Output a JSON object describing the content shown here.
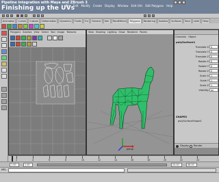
{
  "video_title": {
    "main": "Pipeline integration with Maya and ZBrush 3",
    "subtitle": "Finishing up the UVs"
  },
  "app_menu": [
    "File",
    "Edit",
    "Modify",
    "Create",
    "Display",
    "Window",
    "Edit UVs",
    "Edit Polygons",
    "Help"
  ],
  "shelf_tabs": [
    "Animation",
    "Curves",
    "Custom",
    "Deformation",
    "Dynamics",
    "Fluids",
    "Fur",
    "General",
    "Hair",
    "PaintEffects",
    "Polygons",
    "Rendering",
    "Subdivs",
    "Surfaces",
    "Toon",
    "cloth",
    "Heav"
  ],
  "uv_editor": {
    "menu": [
      "Polygons",
      "Subdivs",
      "View",
      "Select",
      "Tool",
      "Image",
      "Textures"
    ]
  },
  "scene_view": {
    "menu": [
      "View",
      "Shading",
      "Lighting",
      "Show",
      "Renderer",
      "Panels"
    ],
    "camera": "persp"
  },
  "channel_box": {
    "tabs": [
      "Channels",
      "Object"
    ],
    "object_name": "polySurface1",
    "attributes": [
      {
        "name": "Translate X",
        "value": "0"
      },
      {
        "name": "Translate Y",
        "value": "0"
      },
      {
        "name": "Translate Z",
        "value": "0"
      },
      {
        "name": "Rotate X",
        "value": "0"
      },
      {
        "name": "Rotate Y",
        "value": "0"
      },
      {
        "name": "Rotate Z",
        "value": "0"
      },
      {
        "name": "Scale X",
        "value": "1"
      },
      {
        "name": "Scale Y",
        "value": "1"
      },
      {
        "name": "Scale Z",
        "value": "1"
      },
      {
        "name": "Visibility",
        "value": "on"
      }
    ],
    "shapes_header": "SHAPES",
    "shape_name": "polySurfaceShape1",
    "layer_modes": [
      "Display",
      "Render"
    ]
  },
  "timeline": {
    "ticks": [
      "2",
      "4",
      "6",
      "8",
      "10",
      "12",
      "14",
      "16",
      "18",
      "20",
      "22",
      "24"
    ],
    "start": "1.00",
    "range_start": "1.00",
    "range_end": "24.00",
    "end": "48.00"
  },
  "command_line": {
    "label": "MEL"
  },
  "colors": {
    "mesh": "#2fbf6a",
    "wire": "#0a3a1e",
    "selected_uv": "#ffffff",
    "axis_x": "#d02020",
    "axis_y": "#20a020",
    "axis_z": "#2040d0"
  }
}
